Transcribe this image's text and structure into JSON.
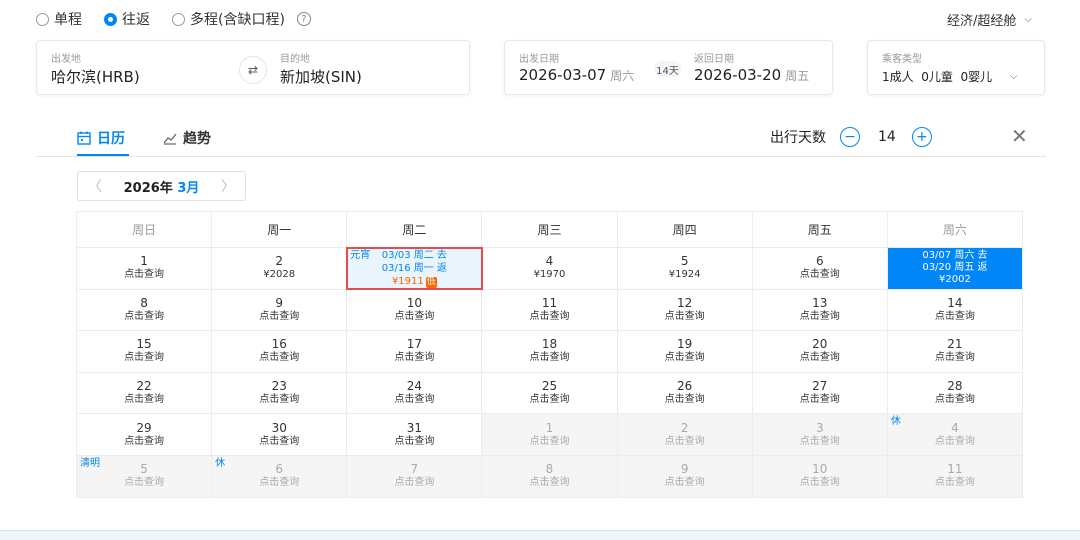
{
  "trip_types": [
    {
      "label": "单程",
      "selected": false
    },
    {
      "label": "往返",
      "selected": true
    },
    {
      "label": "多程(含缺口程)",
      "selected": false
    }
  ],
  "cabin": "经济/超经舱",
  "origin": {
    "label": "出发地",
    "value": "哈尔滨(HRB)"
  },
  "destination": {
    "label": "目的地",
    "value": "新加坡(SIN)"
  },
  "depart": {
    "label": "出发日期",
    "date": "2026-03-07",
    "weekday": "周六"
  },
  "return": {
    "label": "返回日期",
    "date": "2026-03-20",
    "weekday": "周五"
  },
  "duration": "14天",
  "passengers": {
    "label": "乘客类型",
    "value": "1成人  0儿童  0婴儿"
  },
  "tabs": [
    {
      "label": "日历"
    },
    {
      "label": "趋势"
    }
  ],
  "trip_days": {
    "label": "出行天数",
    "value": "14",
    "minus": "−",
    "plus": "+"
  },
  "month_selector": {
    "year": "2026年",
    "month": "3月"
  },
  "weekdays": [
    "周日",
    "周一",
    "周二",
    "周三",
    "周四",
    "周五",
    "周六"
  ],
  "cell_default_price": "点击查询",
  "highlight_cell": {
    "tag": "元宵",
    "line1": "03/03 周二 去",
    "line2": "03/16 周一 返",
    "price": "¥1911",
    "badge": "低"
  },
  "selected_cell": {
    "line1": "03/07 周六 去",
    "line2": "03/20 周五 返",
    "price": "¥2002"
  },
  "weeks": [
    [
      {
        "d": "1",
        "p": "点击查询"
      },
      {
        "d": "2",
        "p": "¥2028"
      },
      {
        "special": "highlight"
      },
      {
        "d": "4",
        "p": "¥1970"
      },
      {
        "d": "5",
        "p": "¥1924"
      },
      {
        "d": "6",
        "p": "点击查询"
      },
      {
        "special": "selected"
      }
    ],
    [
      {
        "d": "8",
        "p": "点击查询"
      },
      {
        "d": "9",
        "p": "点击查询"
      },
      {
        "d": "10",
        "p": "点击查询"
      },
      {
        "d": "11",
        "p": "点击查询"
      },
      {
        "d": "12",
        "p": "点击查询"
      },
      {
        "d": "13",
        "p": "点击查询"
      },
      {
        "d": "14",
        "p": "点击查询"
      }
    ],
    [
      {
        "d": "15",
        "p": "点击查询"
      },
      {
        "d": "16",
        "p": "点击查询"
      },
      {
        "d": "17",
        "p": "点击查询"
      },
      {
        "d": "18",
        "p": "点击查询"
      },
      {
        "d": "19",
        "p": "点击查询"
      },
      {
        "d": "20",
        "p": "点击查询"
      },
      {
        "d": "21",
        "p": "点击查询"
      }
    ],
    [
      {
        "d": "22",
        "p": "点击查询"
      },
      {
        "d": "23",
        "p": "点击查询"
      },
      {
        "d": "24",
        "p": "点击查询"
      },
      {
        "d": "25",
        "p": "点击查询"
      },
      {
        "d": "26",
        "p": "点击查询"
      },
      {
        "d": "27",
        "p": "点击查询"
      },
      {
        "d": "28",
        "p": "点击查询"
      }
    ],
    [
      {
        "d": "29",
        "p": "点击查询"
      },
      {
        "d": "30",
        "p": "点击查询"
      },
      {
        "d": "31",
        "p": "点击查询"
      },
      {
        "d": "1",
        "p": "点击查询",
        "other": true
      },
      {
        "d": "2",
        "p": "点击查询",
        "other": true
      },
      {
        "d": "3",
        "p": "点击查询",
        "other": true
      },
      {
        "d": "4",
        "p": "点击查询",
        "other": true,
        "tag": "休"
      }
    ],
    [
      {
        "d": "5",
        "p": "点击查询",
        "other": true,
        "tag": "清明"
      },
      {
        "d": "6",
        "p": "点击查询",
        "other": true,
        "tag": "休"
      },
      {
        "d": "7",
        "p": "点击查询",
        "other": true
      },
      {
        "d": "8",
        "p": "点击查询",
        "other": true
      },
      {
        "d": "9",
        "p": "点击查询",
        "other": true
      },
      {
        "d": "10",
        "p": "点击查询",
        "other": true
      },
      {
        "d": "11",
        "p": "点击查询",
        "other": true
      }
    ]
  ]
}
